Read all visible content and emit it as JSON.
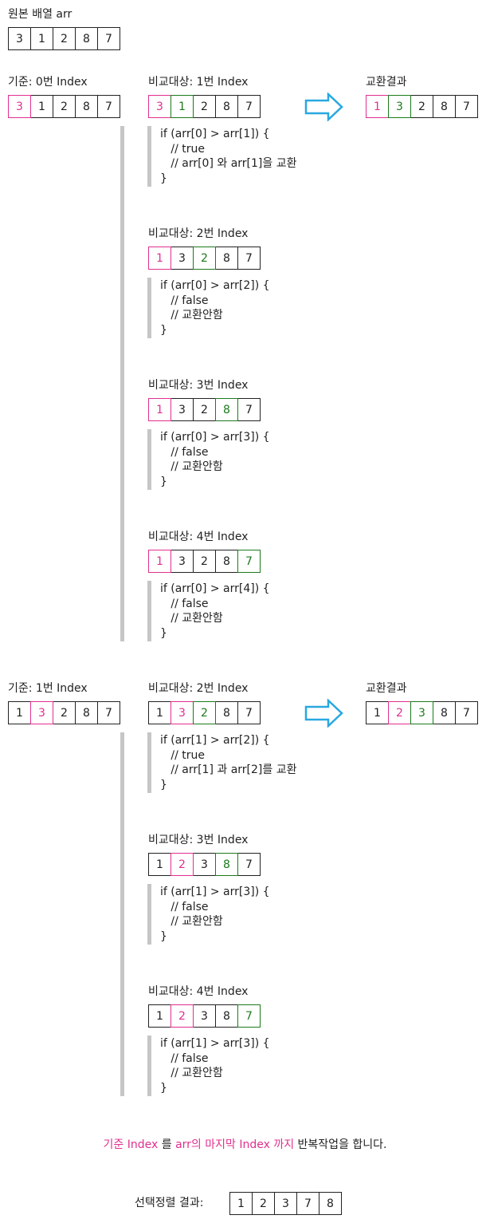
{
  "original": {
    "label": "원본 배열 arr",
    "values": [
      "3",
      "1",
      "2",
      "8",
      "7"
    ]
  },
  "pass0": {
    "base_label": "기준: 0번 Index",
    "base_array": [
      "3",
      "1",
      "2",
      "8",
      "7"
    ],
    "result_label": "교환결과",
    "result_array": [
      "1",
      "3",
      "2",
      "8",
      "7"
    ],
    "comparisons": [
      {
        "label": "비교대상: 1번 Index",
        "array": [
          "3",
          "1",
          "2",
          "8",
          "7"
        ],
        "code": [
          "if (arr[0] > arr[1]) {",
          "   // true",
          "   // arr[0] 와 arr[1]을 교환",
          "}"
        ]
      },
      {
        "label": "비교대상: 2번 Index",
        "array": [
          "1",
          "3",
          "2",
          "8",
          "7"
        ],
        "code": [
          "if (arr[0] > arr[2]) {",
          "   // false",
          "   // 교환안함",
          "}"
        ]
      },
      {
        "label": "비교대상: 3번 Index",
        "array": [
          "1",
          "3",
          "2",
          "8",
          "7"
        ],
        "code": [
          "if (arr[0] > arr[3]) {",
          "   // false",
          "   // 교환안함",
          "}"
        ]
      },
      {
        "label": "비교대상: 4번 Index",
        "array": [
          "1",
          "3",
          "2",
          "8",
          "7"
        ],
        "code": [
          "if (arr[0] > arr[4]) {",
          "   // false",
          "   // 교환안함",
          "}"
        ]
      }
    ]
  },
  "pass1": {
    "base_label": "기준: 1번 Index",
    "base_array": [
      "1",
      "3",
      "2",
      "8",
      "7"
    ],
    "result_label": "교환결과",
    "result_array": [
      "1",
      "2",
      "3",
      "8",
      "7"
    ],
    "comparisons": [
      {
        "label": "비교대상: 2번 Index",
        "array": [
          "1",
          "3",
          "2",
          "8",
          "7"
        ],
        "code": [
          "if (arr[1] > arr[2]) {",
          "   // true",
          "   // arr[1] 과 arr[2]를 교환",
          "}"
        ]
      },
      {
        "label": "비교대상: 3번 Index",
        "array": [
          "1",
          "2",
          "3",
          "8",
          "7"
        ],
        "code": [
          "if (arr[1] > arr[3]) {",
          "   // false",
          "   // 교환안함",
          "}"
        ]
      },
      {
        "label": "비교대상: 4번 Index",
        "array": [
          "1",
          "2",
          "3",
          "8",
          "7"
        ],
        "code": [
          "if (arr[1] > arr[3]) {",
          "   // false",
          "   // 교환안함",
          "}"
        ]
      }
    ]
  },
  "note": {
    "part1": "기준 Index",
    "part2": " 를 ",
    "part3": "arr의 마지막 Index 까지",
    "part4": " 반복작업을 합니다."
  },
  "final": {
    "label": "선택정렬 결과:",
    "values": [
      "1",
      "2",
      "3",
      "7",
      "8"
    ]
  },
  "colors": {
    "base": "#e0308f",
    "target": "#1c7a1c",
    "arrow": "#29a8e0",
    "bar": "#c6c6c6"
  }
}
